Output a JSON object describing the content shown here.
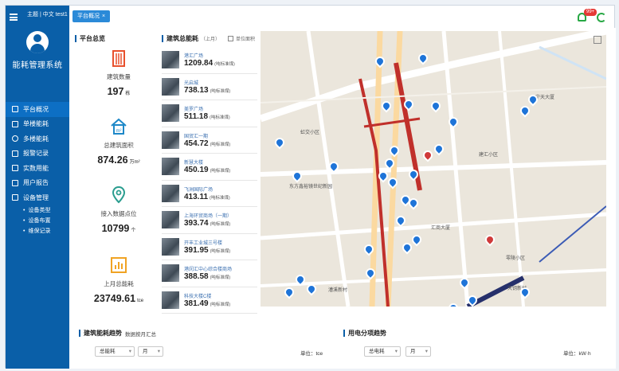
{
  "header": {
    "user_menu": "主题 | 中文  test1 ▾",
    "tab_label": "平台概况",
    "tab_close": "×",
    "notification_count": "99+"
  },
  "sidebar": {
    "app_title": "能耗管理系统",
    "items": [
      {
        "label": "平台概况",
        "icon": "monitor-icon"
      },
      {
        "label": "单楼能耗",
        "icon": "building-icon"
      },
      {
        "label": "多楼能耗",
        "icon": "clock-icon"
      },
      {
        "label": "报警记录",
        "icon": "document-icon"
      },
      {
        "label": "实数用能",
        "icon": "network-icon"
      },
      {
        "label": "用户报告",
        "icon": "report-icon"
      },
      {
        "label": "设备管理",
        "icon": "tools-icon"
      }
    ],
    "subitems": [
      "设备类型",
      "设备布置",
      "维保记录"
    ]
  },
  "overview": {
    "title": "平台总览",
    "items": [
      {
        "label": "建筑数量",
        "value": "197",
        "unit": "栋"
      },
      {
        "label": "总建筑面积",
        "value": "874.26",
        "unit": "万m²"
      },
      {
        "label": "接入数据点位",
        "value": "10799",
        "unit": "个"
      },
      {
        "label": "上月总能耗",
        "value": "23749.61",
        "unit": "tce"
      }
    ]
  },
  "ranking": {
    "title": "建筑总能耗",
    "period": "（上月）",
    "checkbox_label": "单位面积",
    "unit": "(吨标准煤)",
    "rows": [
      {
        "name": "港汇广场",
        "value": "1209.84"
      },
      {
        "name": "光启城",
        "value": "738.13"
      },
      {
        "name": "美罗广场",
        "value": "511.18"
      },
      {
        "name": "国贸汇一期",
        "value": "454.72"
      },
      {
        "name": "新慧大楼",
        "value": "450.19"
      },
      {
        "name": "飞洲国际广场",
        "value": "413.11"
      },
      {
        "name": "上海环贸商场（一期）",
        "value": "393.74"
      },
      {
        "name": "开丰工业城三号楼",
        "value": "391.95"
      },
      {
        "name": "港闵汇中心综合楼商场",
        "value": "388.58"
      },
      {
        "name": "科技大楼C楼",
        "value": "381.49"
      }
    ]
  },
  "map": {
    "labels": [
      "虹交小区",
      "东方鑫裕镜世纪新园",
      "建汇小区",
      "零陵小区",
      "天钥新村",
      "漕溪新村",
      "宁天大厦",
      "汇商大厦"
    ]
  },
  "bottom": {
    "trend": {
      "title": "建筑能耗趋势",
      "subtitle": "数据按月汇总",
      "select1": "总能耗",
      "select2": "月",
      "unit_label": "单位：",
      "unit": "tce"
    },
    "breakdown": {
      "title": "用电分项趋势",
      "select1": "总电耗",
      "select2": "月",
      "unit_label": "单位：",
      "unit": "kW·h"
    }
  }
}
